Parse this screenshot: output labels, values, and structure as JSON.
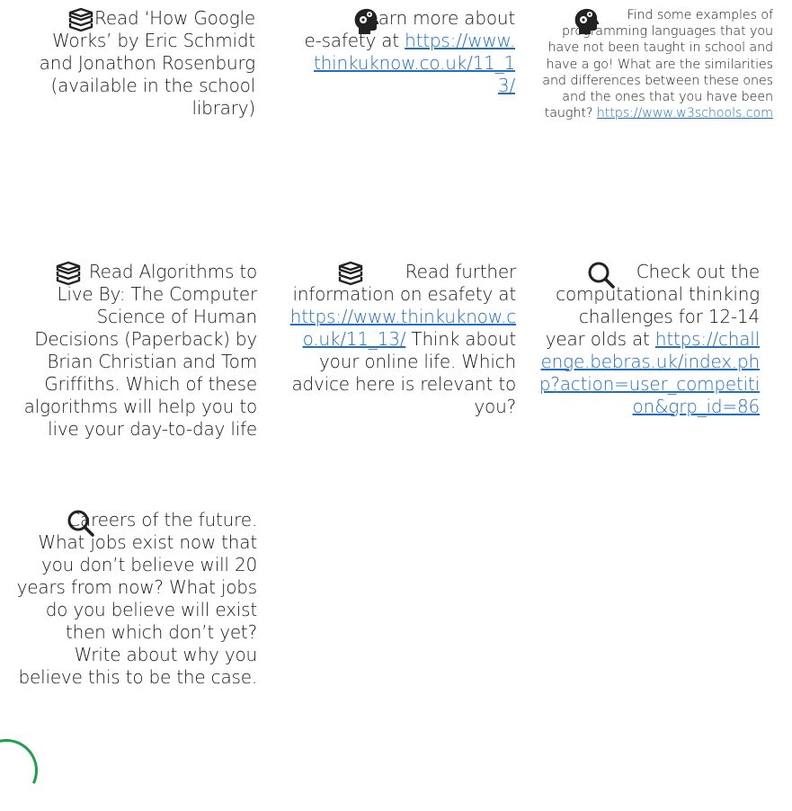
{
  "tasks": [
    {
      "icon": "books-icon",
      "text": "Read ‘How Google Works’ by Eric Schmidt and Jonathon Rosenburg (available in the school library)"
    },
    {
      "icon": "head-gears-icon",
      "text": "Learn more about e-safety at ",
      "link": "https://www.thinkuknow.co.uk/11_13/"
    },
    {
      "icon": "head-gears-icon",
      "text": "Find some examples of programming languages that you have not been taught in school and have a go! What are the similarities and differences between these ones and the ones that you have been taught? ",
      "link": "https://www.w3schools.com"
    },
    {
      "icon": "books-icon",
      "text": "Read Algorithms to Live By: The Computer Science of Human Decisions (Paperback) by Brian Christian and Tom Griffiths. Which of these algorithms will help you to live your day-to-day life"
    },
    {
      "icon": "books-icon",
      "text": "Read further information on esafety at ",
      "link": "https://www.thinkuknow.co.uk/11_13/",
      "text_after": " Think about your online life. Which advice here is relevant to you?"
    },
    {
      "icon": "magnifier-icon",
      "text": "Check out the computational thinking challenges for 12-14 year olds at ",
      "link": "https://challenge.bebras.uk/index.php?action=user_competition&grp_id=86"
    },
    {
      "icon": "magnifier-icon",
      "text": "Careers of the future. What jobs exist now that you don’t believe will 20 years from now? What jobs do you believe will exist then which don’t yet? Write about why you believe this to be the case."
    }
  ],
  "colors": {
    "text": "#1a1a1a",
    "link": "#1f6fc5",
    "accent_arc": "#1aa14a"
  }
}
